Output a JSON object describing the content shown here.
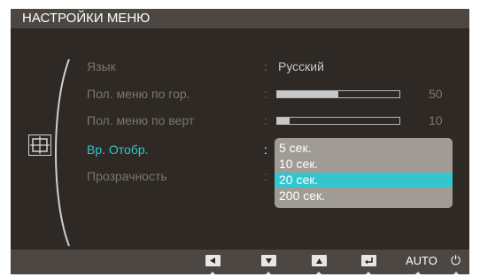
{
  "menu": {
    "title": "НАСТРОЙКИ МЕНЮ"
  },
  "items": [
    {
      "label": "Язык",
      "sep": ":",
      "value": "Русский"
    },
    {
      "label": "Пол. меню по гор.",
      "sep": ":",
      "level": 0.5,
      "number": "50"
    },
    {
      "label": "Пол. меню по верт",
      "sep": ":",
      "level": 0.1,
      "number": "10"
    },
    {
      "label": "Вр. Отобр.",
      "sep": ":"
    },
    {
      "label": "Прозрачность",
      "sep": ":"
    }
  ],
  "dropdown": {
    "options": [
      "5 сек.",
      "10 сек.",
      "20 сек.",
      "200 сек."
    ],
    "selected": "20 сек."
  },
  "bottom_bar": {
    "buttons": [
      "left-arrow-icon",
      "down-arrow-icon",
      "up-arrow-icon",
      "enter-icon"
    ],
    "auto_label": "AUTO",
    "power_label": "⏻"
  },
  "colors": {
    "accent": "#33c6cc",
    "panel": "#2e2925",
    "bar": "#4c4743"
  },
  "category_icon": "screen-position-icon"
}
